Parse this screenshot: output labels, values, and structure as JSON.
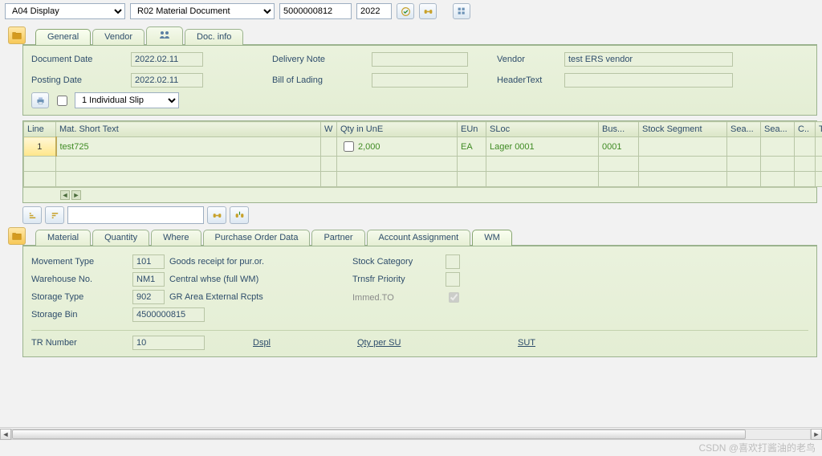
{
  "topbar": {
    "transaction": "A04 Display",
    "ref_doc": "R02 Material Document",
    "doc_number": "5000000812",
    "year": "2022"
  },
  "header_tabs": [
    "General",
    "Vendor",
    "",
    "Doc. info"
  ],
  "header_active_tab": 0,
  "header": {
    "document_date_label": "Document Date",
    "document_date": "2022.02.11",
    "posting_date_label": "Posting Date",
    "posting_date": "2022.02.11",
    "delivery_note_label": "Delivery Note",
    "delivery_note": "",
    "bill_of_lading_label": "Bill of Lading",
    "bill_of_lading": "",
    "vendor_label": "Vendor",
    "vendor": "test ERS vendor",
    "header_text_label": "HeaderText",
    "header_text": "",
    "slip_mode": "1 Individual Slip"
  },
  "items": {
    "columns": [
      "Line",
      "Mat. Short Text",
      "W",
      "Qty in UnE",
      "EUn",
      "SLoc",
      "Bus...",
      "Stock Segment",
      "Sea...",
      "Sea...",
      "C..",
      "Th..."
    ],
    "rows": [
      {
        "line": "1",
        "mat_short_text": "test725",
        "w": "",
        "qty": "2,000",
        "eun": "EA",
        "sloc": "Lager 0001",
        "bus": "0001",
        "stock_segment": "",
        "sea1": "",
        "sea2": "",
        "c": "",
        "th": ""
      }
    ]
  },
  "detail_tabs": [
    "Material",
    "Quantity",
    "Where",
    "Purchase Order Data",
    "Partner",
    "Account Assignment",
    "WM"
  ],
  "detail_active_tab": 6,
  "wm": {
    "movement_type_label": "Movement Type",
    "movement_type_code": "101",
    "movement_type_text": "Goods receipt for pur.or.",
    "warehouse_no_label": "Warehouse No.",
    "warehouse_no_code": "NM1",
    "warehouse_no_text": "Central whse (full WM)",
    "storage_type_label": "Storage Type",
    "storage_type_code": "902",
    "storage_type_text": "GR Area External Rcpts",
    "storage_bin_label": "Storage Bin",
    "storage_bin": "4500000815",
    "stock_category_label": "Stock Category",
    "trnsfr_priority_label": "Trnsfr Priority",
    "immed_to_label": "Immed.TO",
    "immed_to_checked": true,
    "tr_number_label": "TR Number",
    "tr_number": "10",
    "dspl_label": "Dspl",
    "qty_per_su_label": "Qty per SU",
    "sut_label": "SUT"
  },
  "watermark": "CSDN @喜欢打酱油的老鸟"
}
